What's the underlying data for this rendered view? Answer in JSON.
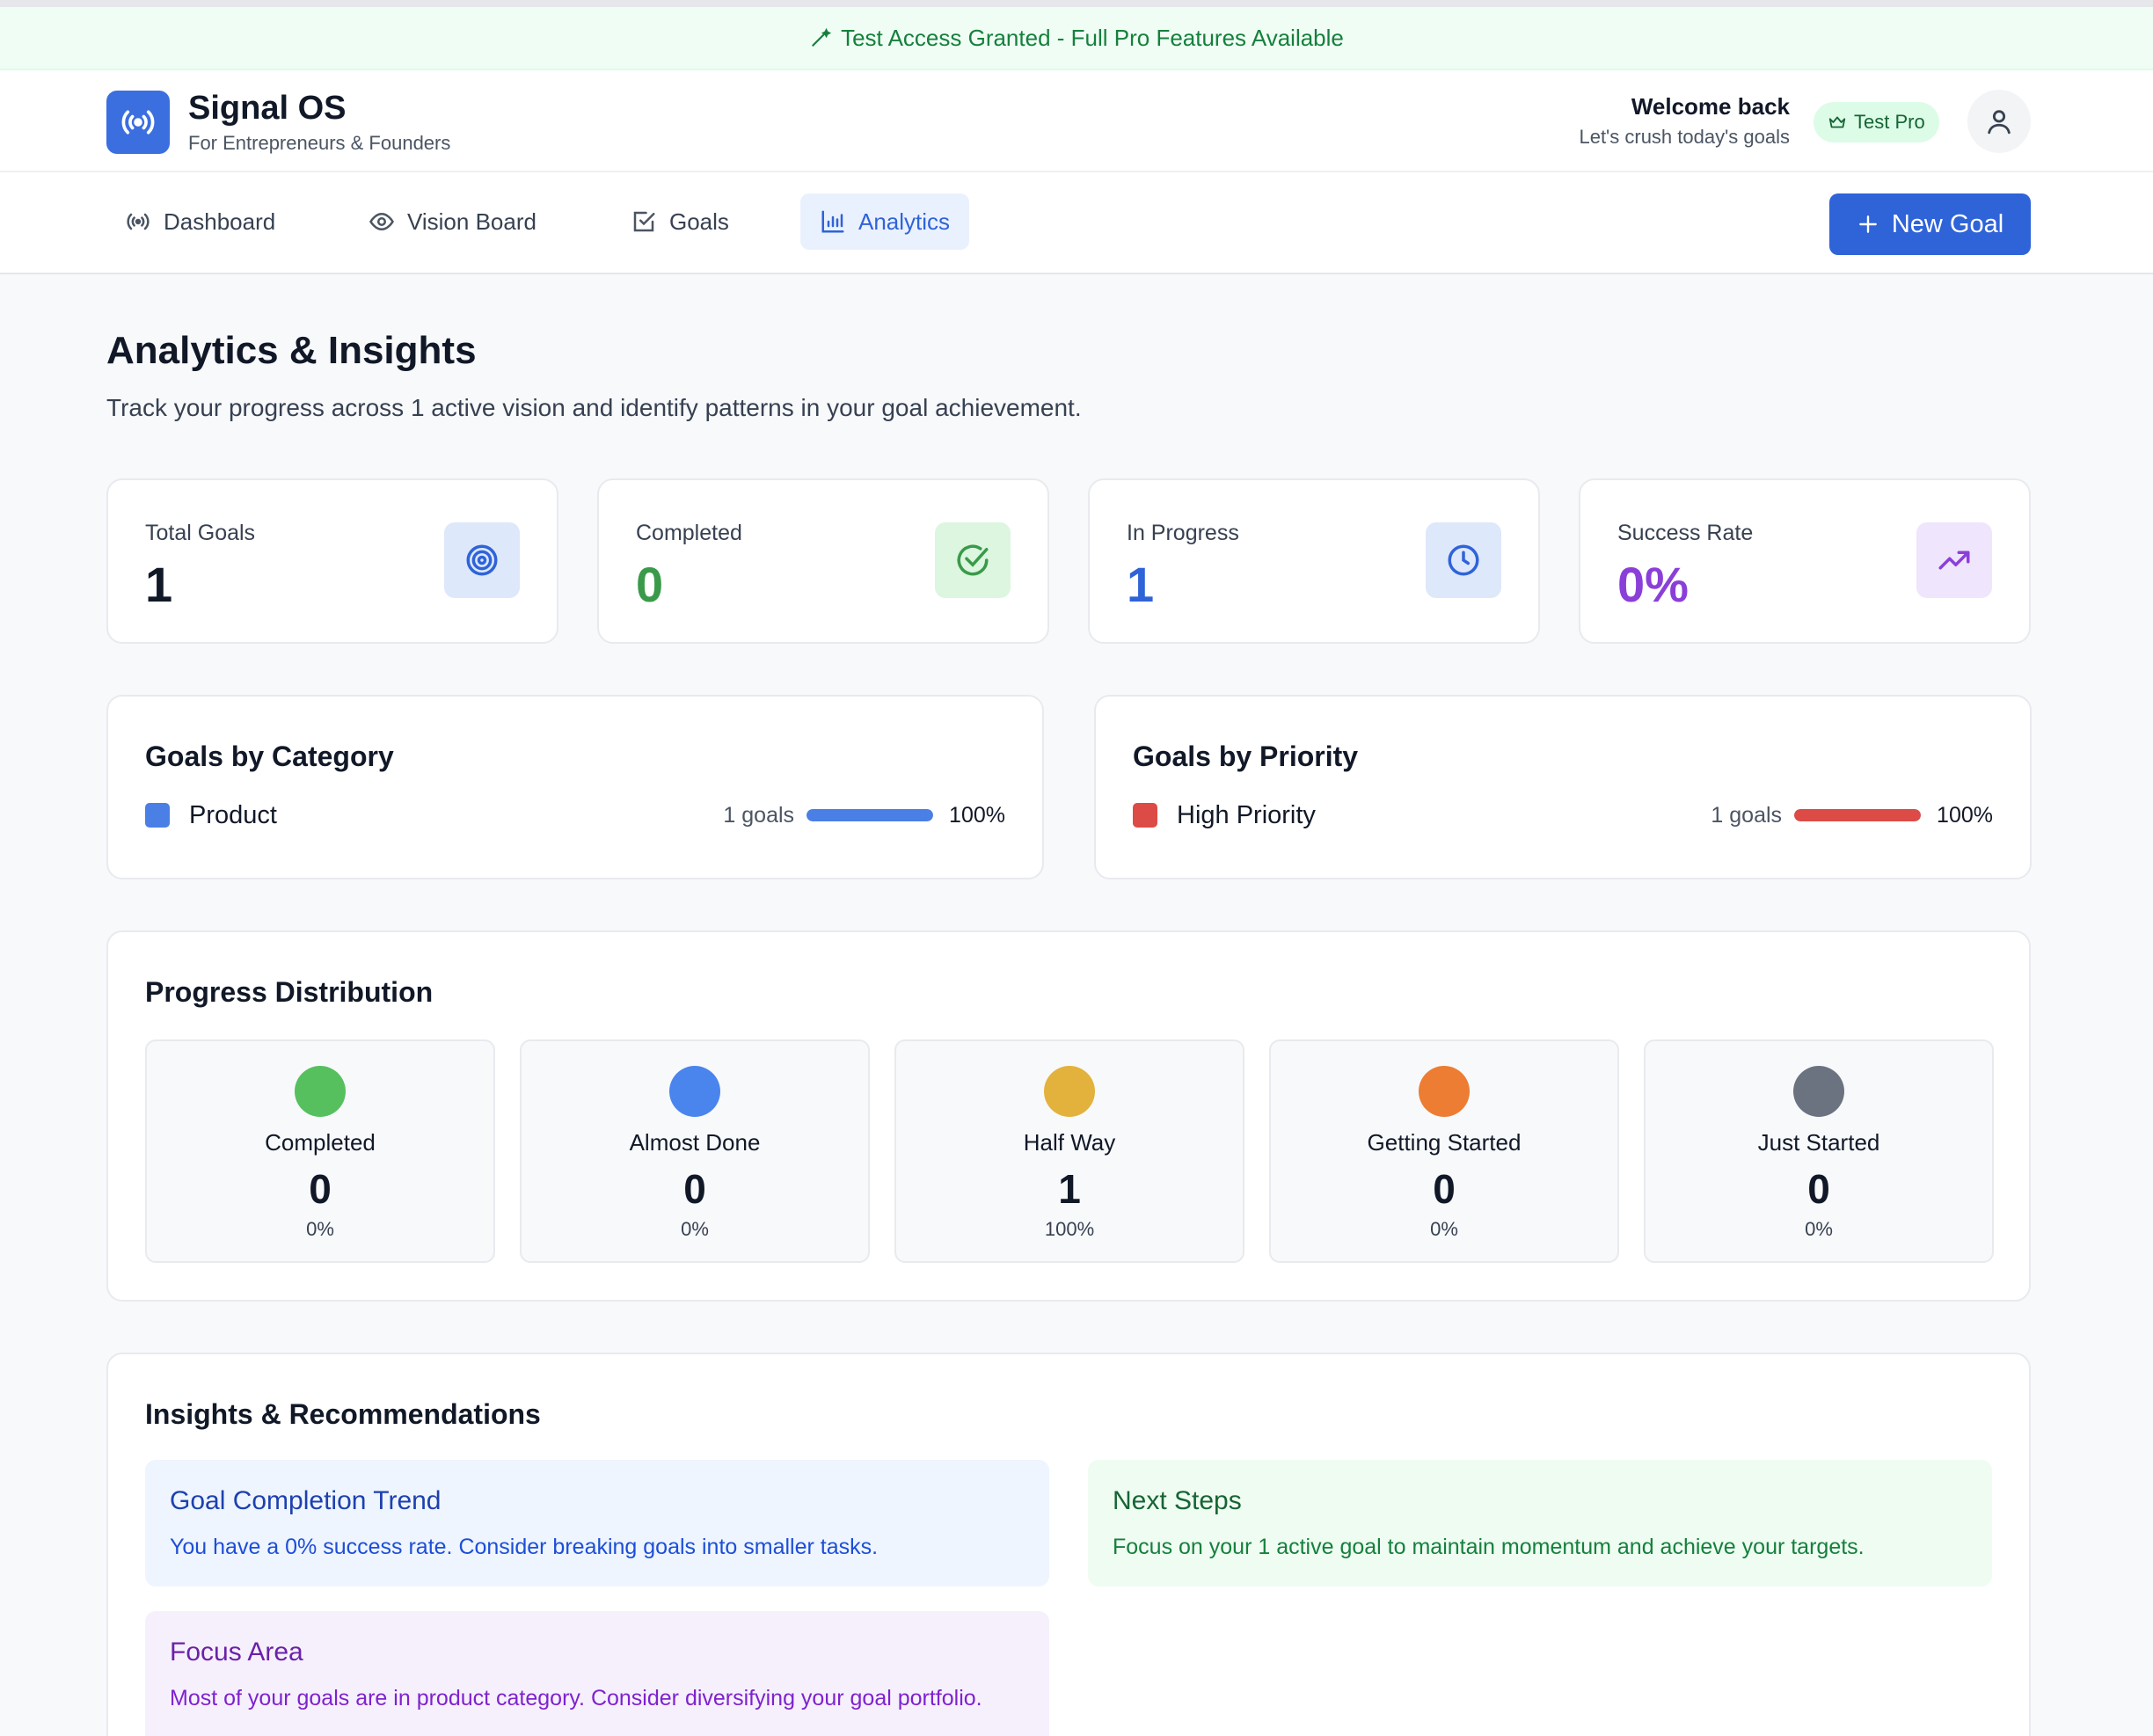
{
  "banner": {
    "text": "Test Access Granted - Full Pro Features Available",
    "icon": "wand-icon"
  },
  "header": {
    "brand": "Signal OS",
    "tagline": "For Entrepreneurs & Founders",
    "welcome": "Welcome back",
    "welcome_sub": "Let's crush today's goals",
    "badge": "Test Pro",
    "logo_icon": "signal-icon"
  },
  "nav": {
    "items": [
      {
        "label": "Dashboard",
        "icon": "signal-icon"
      },
      {
        "label": "Vision Board",
        "icon": "eye-icon"
      },
      {
        "label": "Goals",
        "icon": "check-square-icon"
      },
      {
        "label": "Analytics",
        "icon": "bar-chart-icon",
        "active": true
      }
    ],
    "new_goal": "New Goal"
  },
  "page": {
    "title": "Analytics & Insights",
    "subtitle": "Track your progress across 1 active vision and identify patterns in your goal achievement."
  },
  "stats": [
    {
      "label": "Total Goals",
      "value": "1",
      "color": "#111827",
      "icon": "target-icon"
    },
    {
      "label": "Completed",
      "value": "0",
      "color": "#3a9a4a",
      "icon": "check-circle-icon"
    },
    {
      "label": "In Progress",
      "value": "1",
      "color": "#2f63d8",
      "icon": "clock-icon"
    },
    {
      "label": "Success Rate",
      "value": "0%",
      "color": "#8b3fd9",
      "icon": "trending-up-icon"
    }
  ],
  "category": {
    "title": "Goals by Category",
    "items": [
      {
        "name": "Product",
        "count": "1 goals",
        "percent": "100%",
        "fraction": 1.0,
        "color": "#4a7fe6"
      }
    ]
  },
  "priority": {
    "title": "Goals by Priority",
    "items": [
      {
        "name": "High Priority",
        "count": "1 goals",
        "percent": "100%",
        "fraction": 1.0,
        "color": "#dc4b46"
      }
    ]
  },
  "distribution": {
    "title": "Progress Distribution",
    "items": [
      {
        "label": "Completed",
        "value": "0",
        "percent": "0%",
        "color": "#56c05f"
      },
      {
        "label": "Almost Done",
        "value": "0",
        "percent": "0%",
        "color": "#4a85ee"
      },
      {
        "label": "Half Way",
        "value": "1",
        "percent": "100%",
        "color": "#e3b23c"
      },
      {
        "label": "Getting Started",
        "value": "0",
        "percent": "0%",
        "color": "#ec7d33"
      },
      {
        "label": "Just Started",
        "value": "0",
        "percent": "0%",
        "color": "#6b7280"
      }
    ]
  },
  "insights": {
    "title": "Insights & Recommendations",
    "items": [
      {
        "title": "Goal Completion Trend",
        "text": "You have a 0% success rate. Consider breaking goals into smaller tasks."
      },
      {
        "title": "Next Steps",
        "text": "Focus on your 1 active goal to maintain momentum and achieve your targets."
      },
      {
        "title": "Focus Area",
        "text": "Most of your goals are in product category. Consider diversifying your goal portfolio."
      }
    ]
  }
}
